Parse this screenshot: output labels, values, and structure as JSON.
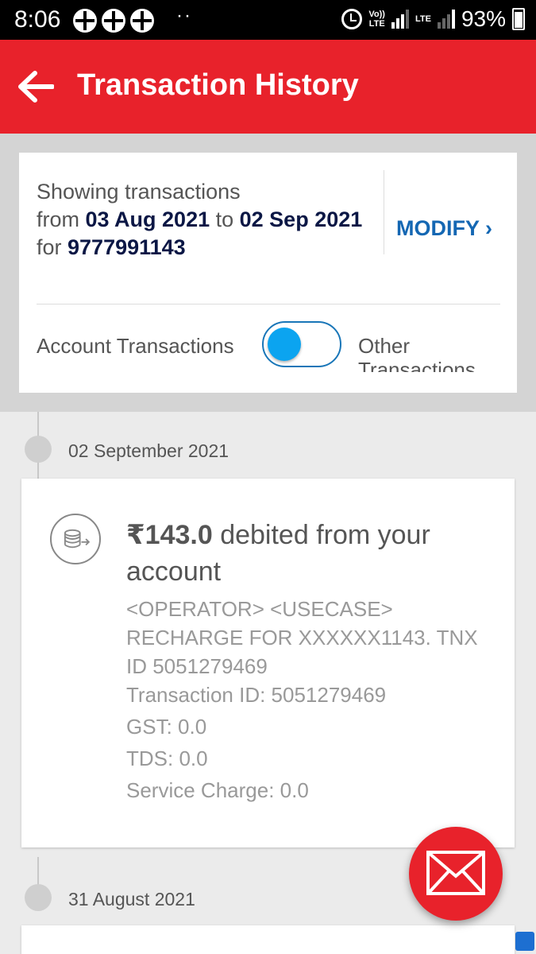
{
  "status_bar": {
    "time": "8:06",
    "dots": "··",
    "network": "LTE",
    "volte": "Vo)) LTE",
    "battery": "93%"
  },
  "header": {
    "title": "Transaction History",
    "back_icon": "arrow-left-icon",
    "color": "#e8222b"
  },
  "filter": {
    "line1": "Showing transactions",
    "from_prefix": "from ",
    "from_date": "03 Aug 2021",
    "to_word": " to ",
    "to_date": "02 Sep 2021",
    "for_prefix": "for ",
    "number": "9777991143",
    "modify_label": "MODIFY ›",
    "toggle_left": "Account Transactions",
    "toggle_right": "Other Transactions",
    "toggle_state": "left"
  },
  "transactions": [
    {
      "date": "02 September 2021",
      "amount": "₹143.0",
      "summary": " debited from your account",
      "description": "<OPERATOR> <USECASE> RECHARGE FOR XXXXXX1143. TNX ID 5051279469",
      "transaction_id": "Transaction ID: 5051279469",
      "gst": "GST: 0.0",
      "tds": "TDS: 0.0",
      "service_charge": "Service Charge: 0.0",
      "icon": "coins-transfer-icon"
    },
    {
      "date": "31 August 2021"
    }
  ],
  "fab": {
    "icon": "mail-icon"
  }
}
